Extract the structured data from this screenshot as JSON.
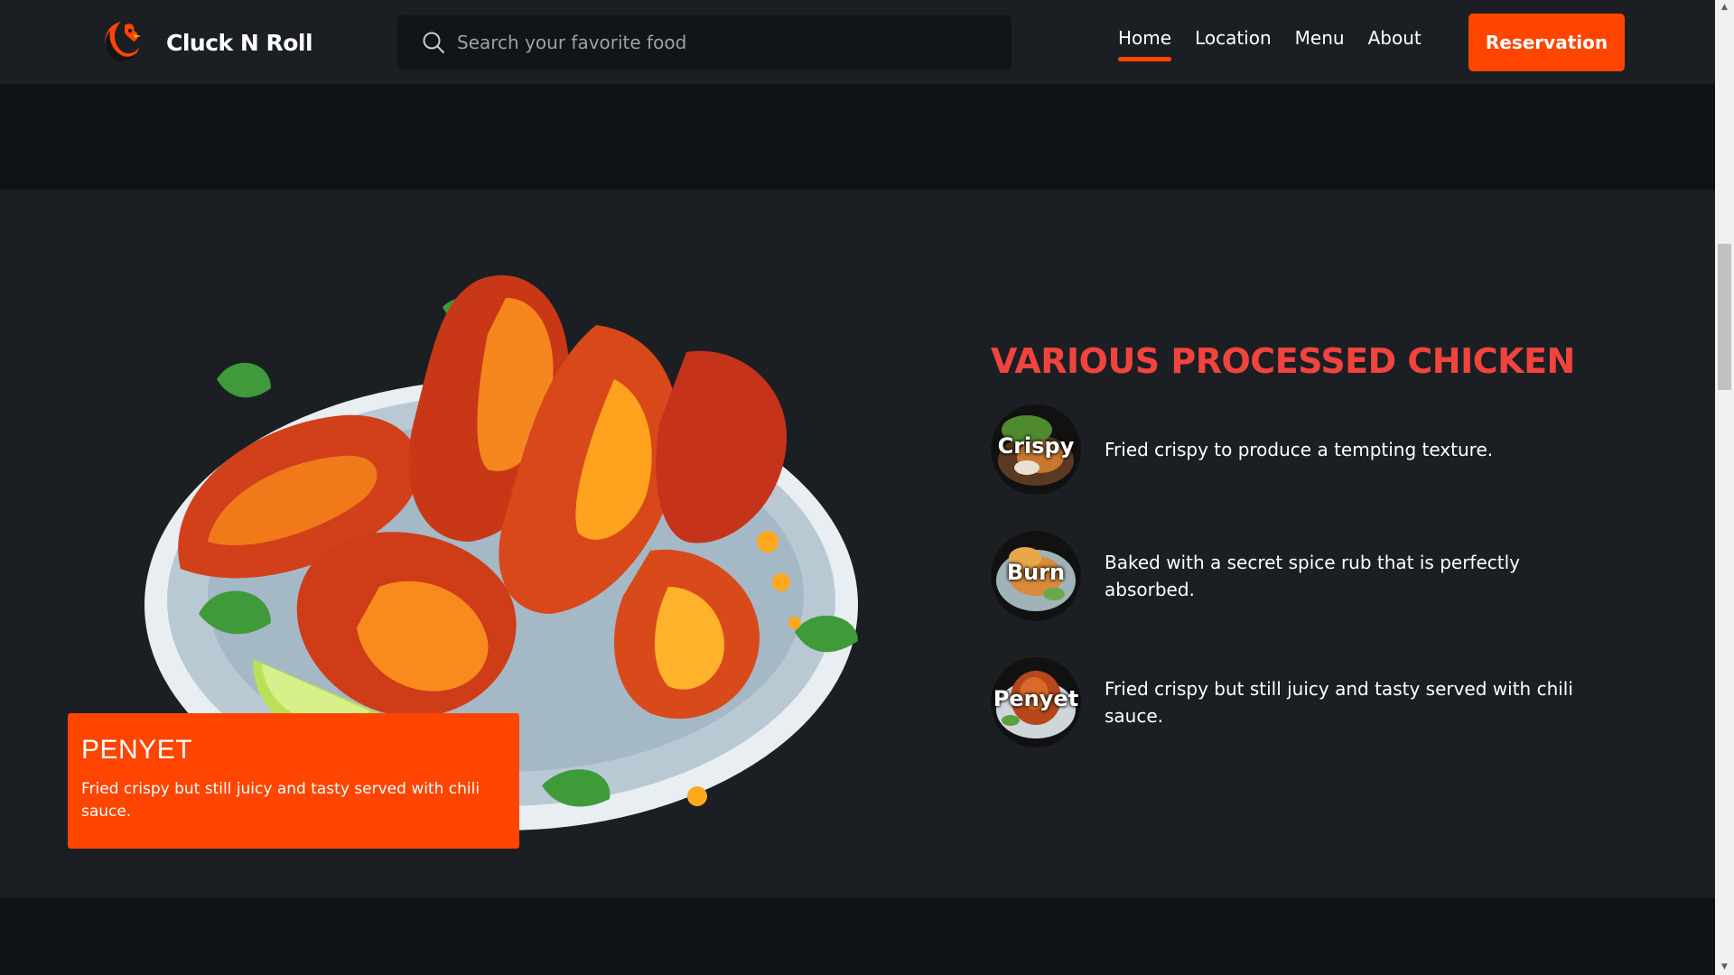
{
  "header": {
    "brand_name": "Cluck N Roll",
    "logo_icon": "rooster-logo-icon",
    "search": {
      "placeholder": "Search your favorite food",
      "value": "",
      "icon": "search-icon"
    },
    "nav": [
      {
        "label": "Home",
        "active": true
      },
      {
        "label": "Location",
        "active": false
      },
      {
        "label": "Menu",
        "active": false
      },
      {
        "label": "About",
        "active": false
      }
    ],
    "reservation_label": "Reservation"
  },
  "feature": {
    "image": "chicken-wings-plate-illustration",
    "promo": {
      "title": "PENYET",
      "description": "Fried crispy but still juicy and tasty served with chili sauce."
    },
    "title": "VARIOUS PROCESSED CHICKEN",
    "items": [
      {
        "thumb_label": "Crispy",
        "description": "Fried crispy to produce a tempting texture."
      },
      {
        "thumb_label": "Burn",
        "description": "Baked with a secret spice rub that is perfectly absorbed."
      },
      {
        "thumb_label": "Penyet",
        "description": "Fried crispy but still juicy and tasty served with chili sauce."
      }
    ]
  },
  "colors": {
    "accent": "#ff4500",
    "title_red": "#f0443d",
    "header_bg": "#1b1f24",
    "section_bg": "#1b1f24",
    "strip_bg": "#0e1216"
  },
  "scrollbar": {
    "up_icon": "scroll-up-arrow-icon",
    "down_icon": "scroll-down-arrow-icon"
  }
}
